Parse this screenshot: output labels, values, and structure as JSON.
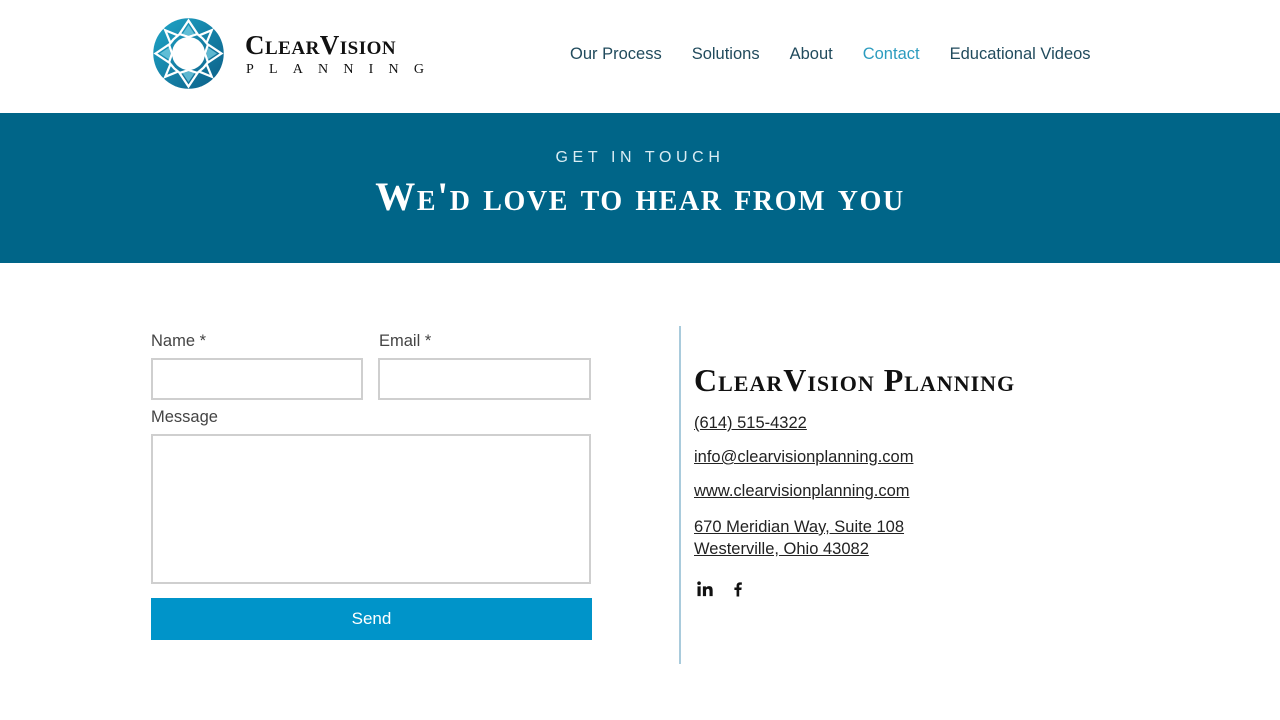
{
  "brand": {
    "name": "ClearVision",
    "tagline": "PLANNING",
    "logo_icon": "circular-mosaic-logo-icon",
    "colors": {
      "accent": "#2c9cbf",
      "banner": "#006588",
      "button": "#0094c9",
      "nav": "#214b5d"
    }
  },
  "nav": {
    "items": [
      {
        "label": "Our Process"
      },
      {
        "label": "Solutions"
      },
      {
        "label": "About"
      },
      {
        "label": "Contact",
        "active": true
      },
      {
        "label": "Educational Videos"
      }
    ]
  },
  "banner": {
    "eyebrow": "GET IN TOUCH",
    "title": "We'd love to hear from you"
  },
  "form": {
    "name_label": "Name *",
    "name_value": "",
    "email_label": "Email *",
    "email_value": "",
    "message_label": "Message",
    "message_value": "",
    "send_label": "Send"
  },
  "contact": {
    "company": "ClearVision Planning",
    "phone": "(614) 515-4322",
    "email": "info@clearvisionplanning.com",
    "website": "www.clearvisionplanning.com",
    "address_line1": "670 Meridian Way, Suite 108",
    "address_line2": "Westerville, Ohio 43082",
    "socials": [
      {
        "icon": "linkedin-icon"
      },
      {
        "icon": "facebook-icon"
      }
    ]
  }
}
